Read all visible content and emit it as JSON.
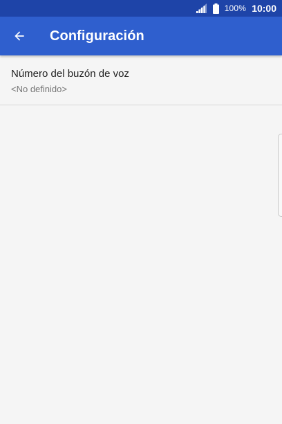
{
  "status_bar": {
    "battery_percent": "100%",
    "time": "10:00",
    "icons": [
      "signal-icon",
      "battery-icon"
    ]
  },
  "app_bar": {
    "title": "Configuración",
    "back_icon": "arrow-back-icon"
  },
  "settings": [
    {
      "title": "Número del buzón de voz",
      "summary": "<No definido>"
    }
  ],
  "colors": {
    "status_bar": "#1e44a8",
    "app_bar": "#2f5fce",
    "background": "#f5f5f5",
    "primary_text": "#212121",
    "secondary_text": "#757575",
    "divider": "#d6d6d6"
  }
}
